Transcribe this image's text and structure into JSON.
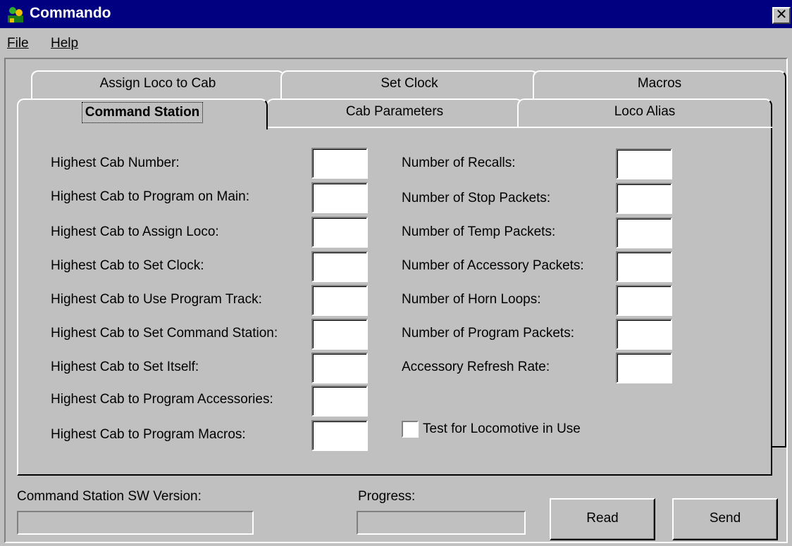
{
  "window": {
    "title": "Commando",
    "close_label": "✕"
  },
  "menu": {
    "file": "File",
    "help": "Help"
  },
  "tabs": {
    "back": [
      "Assign Loco to Cab",
      "Set Clock",
      "Macros"
    ],
    "front": [
      "Command Station",
      "Cab Parameters",
      "Loco Alias"
    ],
    "active": "Command Station"
  },
  "left_fields": [
    {
      "label": "Highest Cab Number:",
      "value": ""
    },
    {
      "label": "Highest Cab to Program on Main:",
      "value": ""
    },
    {
      "label": "Highest Cab to Assign Loco:",
      "value": ""
    },
    {
      "label": "Highest Cab to Set Clock:",
      "value": ""
    },
    {
      "label": "Highest Cab to Use Program Track:",
      "value": ""
    },
    {
      "label": "Highest Cab to Set Command Station:",
      "value": ""
    },
    {
      "label": "Highest Cab to Set Itself:",
      "value": ""
    },
    {
      "label": "Highest Cab to Program Accessories:",
      "value": ""
    },
    {
      "label": "Highest Cab to Program Macros:",
      "value": ""
    }
  ],
  "right_fields": [
    {
      "label": "Number of Recalls:",
      "value": ""
    },
    {
      "label": "Number of Stop Packets:",
      "value": ""
    },
    {
      "label": "Number of Temp Packets:",
      "value": ""
    },
    {
      "label": "Number of Accessory Packets:",
      "value": ""
    },
    {
      "label": "Number of Horn Loops:",
      "value": ""
    },
    {
      "label": "Number of Program Packets:",
      "value": ""
    },
    {
      "label": "Accessory Refresh Rate:",
      "value": ""
    }
  ],
  "checkbox": {
    "label": "Test for Locomotive in Use",
    "checked": false
  },
  "footer": {
    "version_label": "Command Station SW Version:",
    "version_value": "",
    "progress_label": "Progress:",
    "progress": 0,
    "read_label": "Read",
    "send_label": "Send"
  },
  "colors": {
    "title_bar": "#000080",
    "face": "#c0c0c0",
    "field": "#ffffff"
  }
}
